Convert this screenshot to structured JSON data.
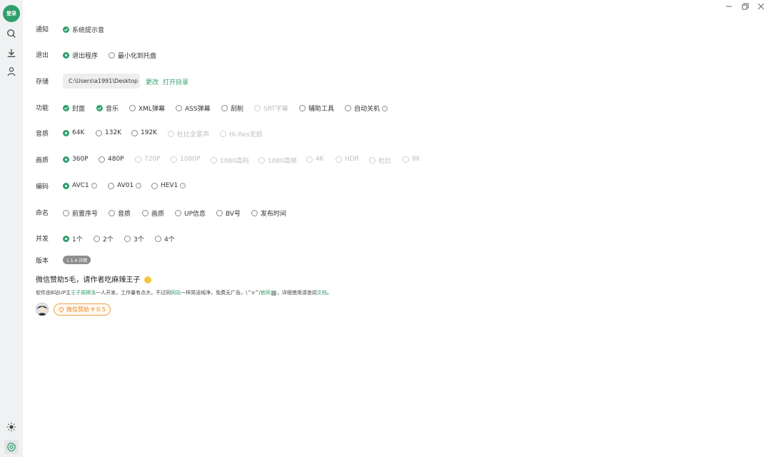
{
  "sidebar": {
    "login_label": "登录",
    "items": [
      {
        "icon": "search-icon"
      },
      {
        "icon": "download-icon"
      },
      {
        "icon": "user-icon"
      }
    ],
    "bottom": [
      {
        "icon": "theme-icon"
      },
      {
        "icon": "settings-icon",
        "active": true
      }
    ]
  },
  "window_controls": [
    "minimize",
    "restore",
    "close"
  ],
  "settings": {
    "notify": {
      "label": "通知",
      "options": [
        {
          "text": "系统提示音",
          "checked": true
        }
      ]
    },
    "exit": {
      "label": "退出",
      "options": [
        {
          "text": "退出程序",
          "selected": true
        },
        {
          "text": "最小化到托盘",
          "selected": false
        }
      ]
    },
    "storage": {
      "label": "存储",
      "path": "C:\\Users\\a1991\\Desktop",
      "change_label": "更改",
      "open_label": "打开目录"
    },
    "features": {
      "label": "功能",
      "options": [
        {
          "text": "封面",
          "checked": true
        },
        {
          "text": "音乐",
          "checked": true
        },
        {
          "text": "XML弹幕",
          "checked": false
        },
        {
          "text": "ASS弹幕",
          "checked": false
        },
        {
          "text": "刮削",
          "checked": false
        },
        {
          "text": "SRT字幕",
          "checked": false,
          "disabled": true
        },
        {
          "text": "辅助工具",
          "checked": false
        },
        {
          "text": "自动关机",
          "checked": false
        }
      ]
    },
    "audio_quality": {
      "label": "音质",
      "options": [
        {
          "text": "64K",
          "selected": true
        },
        {
          "text": "132K"
        },
        {
          "text": "192K"
        },
        {
          "text": "杜比全景声",
          "disabled": true
        },
        {
          "text": "Hi-Res无损",
          "disabled": true
        }
      ]
    },
    "video_quality": {
      "label": "画质",
      "options": [
        {
          "text": "360P",
          "selected": true
        },
        {
          "text": "480P"
        },
        {
          "text": "720P",
          "disabled": true
        },
        {
          "text": "1080P",
          "disabled": true
        },
        {
          "text": "1080高码",
          "disabled": true
        },
        {
          "text": "1080高帧",
          "disabled": true
        },
        {
          "text": "4K",
          "disabled": true
        },
        {
          "text": "HDR",
          "disabled": true
        },
        {
          "text": "杜比",
          "disabled": true
        },
        {
          "text": "8K",
          "disabled": true
        }
      ]
    },
    "codec": {
      "label": "编码",
      "options": [
        {
          "text": "AVC1",
          "selected": true
        },
        {
          "text": "AV01"
        },
        {
          "text": "HEV1"
        }
      ]
    },
    "naming": {
      "label": "命名",
      "options": [
        {
          "text": "前置序号"
        },
        {
          "text": "音质"
        },
        {
          "text": "画质"
        },
        {
          "text": "UP信息"
        },
        {
          "text": "BV号"
        },
        {
          "text": "发布时间"
        }
      ]
    },
    "concurrency": {
      "label": "并发",
      "options": [
        {
          "text": "1个",
          "selected": true
        },
        {
          "text": "2个"
        },
        {
          "text": "3个"
        },
        {
          "text": "4个"
        }
      ]
    },
    "version": {
      "label": "版本",
      "badge": "1.1.4 详情"
    }
  },
  "donate": {
    "title": "微信赞助5毛，请作者吃麻辣王子",
    "desc_parts": {
      "p1": "软件由B站UP主",
      "author": "王子周棋洛",
      "p2": "一人开发，工作量有点大，不过同",
      "site": "网站",
      "p3": "一样简洁纯净，免费无广告。\\^o^/",
      "official": "官网",
      "p4": "，详细使用请查阅",
      "docs": "文档",
      "p5": "。"
    },
    "button_label": "微信赞助 ¥ 0.5"
  },
  "colors": {
    "accent": "#2e9f6b",
    "donate": "#e8892a",
    "sidebar_bg": "#f0f1f2"
  }
}
